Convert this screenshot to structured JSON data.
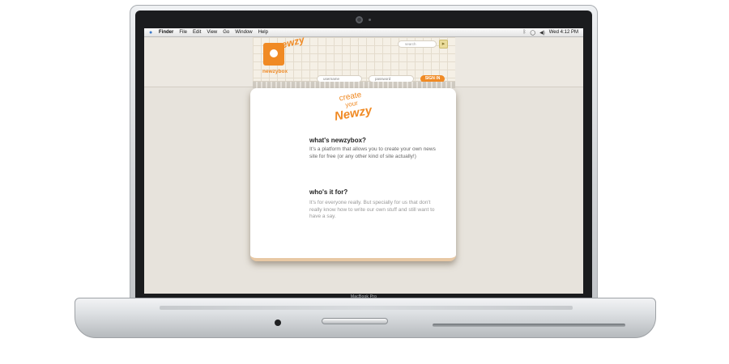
{
  "device": {
    "label": "MacBook Pro"
  },
  "menubar": {
    "apple_icon": "apple-icon",
    "items": [
      "Finder",
      "File",
      "Edit",
      "View",
      "Go",
      "Window",
      "Help"
    ],
    "clock": "Wed 4:12 PM",
    "status_icons": [
      "bluetooth-icon",
      "chat-icon",
      "volume-icon"
    ]
  },
  "site": {
    "brand_word": "newzy",
    "brand_name": "newzybox",
    "search_placeholder": "search",
    "username_placeholder": "username",
    "password_placeholder": "password",
    "signin_label": "SIGN IN",
    "accent_color": "#f08a24",
    "create_logo": {
      "line1": "create",
      "line2": "your",
      "line3": "Newzy"
    },
    "sections": [
      {
        "heading": "what's newzybox?",
        "body": "It's a platform that allows you to create your own news site for free (or any other kind of site actually!)"
      },
      {
        "heading": "who's it for?",
        "body": "It's for everyone really. But specially for us that don't really know how to write our own stuff and still want to have a say."
      }
    ]
  }
}
